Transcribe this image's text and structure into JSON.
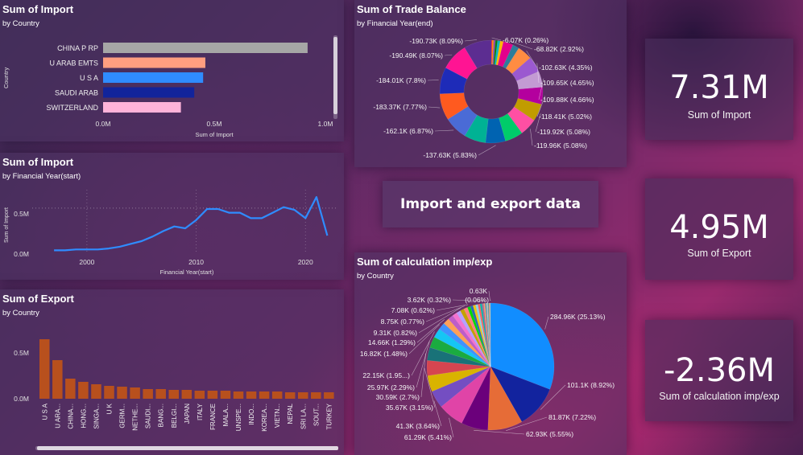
{
  "import_bar": {
    "title": "Sum of Import",
    "subtitle": "by Country",
    "ylabel": "Country",
    "xlabel": "Sum of Import",
    "ticks": [
      "0.0M",
      "0.5M",
      "1.0M"
    ]
  },
  "import_line": {
    "title": "Sum of Import",
    "subtitle": "by Financial Year(start)",
    "ylabel": "Sum of Import",
    "xlabel": "Financial Year(start)",
    "yticks": [
      "0.0M",
      "0.5M"
    ],
    "xticks": [
      "2000",
      "2010",
      "2020"
    ]
  },
  "export_bar": {
    "title": "Sum of Export",
    "subtitle": "by Country",
    "yticks": [
      "0.0M",
      "0.5M"
    ]
  },
  "trade_donut": {
    "title": "Sum of Trade Balance",
    "subtitle": "by Financial Year(end)"
  },
  "calc_pie": {
    "title": "Sum of calculation imp/exp",
    "subtitle": "by Country"
  },
  "banner": {
    "text": "Import and export data"
  },
  "kpis": [
    {
      "value": "7.31M",
      "label": "Sum of Import"
    },
    {
      "value": "4.95M",
      "label": "Sum of Export"
    },
    {
      "value": "-2.36M",
      "label": "Sum of calculation imp/exp"
    }
  ],
  "chart_data": [
    {
      "type": "bar",
      "orientation": "horizontal",
      "title": "Sum of Import",
      "subtitle": "by Country",
      "xlabel": "Sum of Import",
      "ylabel": "Country",
      "categories": [
        "CHINA P RP",
        "U ARAB EMTS",
        "U S A",
        "SAUDI ARAB",
        "SWITZERLAND"
      ],
      "values": [
        0.92,
        0.46,
        0.45,
        0.41,
        0.35
      ],
      "unit": "M",
      "xlim": [
        0,
        1.0
      ],
      "colors": [
        "#a6a6a6",
        "#ff9e80",
        "#2f8cff",
        "#12249b",
        "#ffb3d9"
      ]
    },
    {
      "type": "line",
      "title": "Sum of Import",
      "subtitle": "by Financial Year(start)",
      "xlabel": "Financial Year(start)",
      "ylabel": "Sum of Import",
      "x": [
        1997,
        1998,
        1999,
        2000,
        2001,
        2002,
        2003,
        2004,
        2005,
        2006,
        2007,
        2008,
        2009,
        2010,
        2011,
        2012,
        2013,
        2014,
        2015,
        2016,
        2017,
        2018,
        2019,
        2020,
        2021,
        2022
      ],
      "values": [
        0.04,
        0.04,
        0.05,
        0.05,
        0.05,
        0.06,
        0.08,
        0.11,
        0.14,
        0.19,
        0.25,
        0.3,
        0.28,
        0.37,
        0.49,
        0.49,
        0.45,
        0.45,
        0.39,
        0.39,
        0.45,
        0.51,
        0.48,
        0.39,
        0.62,
        0.2
      ],
      "unit": "M",
      "ylim": [
        0,
        0.7
      ],
      "xlim": [
        1995,
        2023
      ],
      "color": "#2f8cff"
    },
    {
      "type": "bar",
      "title": "Sum of Export",
      "subtitle": "by Country",
      "categories": [
        "U S A",
        "U ARA...",
        "CHINA...",
        "HONG...",
        "SINGA...",
        "U K",
        "GERM...",
        "NETHE...",
        "SAUDI...",
        "BANG...",
        "BELGI...",
        "JAPAN",
        "ITALY",
        "FRANCE",
        "MALA...",
        "UNSPE...",
        "INDO...",
        "KOREA...",
        "VIETN...",
        "NEPAL",
        "SRI LA...",
        "SOUT...",
        "TURKEY"
      ],
      "values": [
        0.74,
        0.48,
        0.25,
        0.21,
        0.18,
        0.16,
        0.15,
        0.14,
        0.12,
        0.12,
        0.11,
        0.11,
        0.1,
        0.1,
        0.1,
        0.09,
        0.09,
        0.09,
        0.09,
        0.08,
        0.08,
        0.08,
        0.08
      ],
      "unit": "M",
      "ylim": [
        0,
        0.9
      ],
      "color": "#b8501d"
    },
    {
      "type": "pie",
      "variant": "donut",
      "title": "Sum of Trade Balance",
      "subtitle": "by Financial Year(end)",
      "slices": [
        {
          "label": "-6.07K (0.26%)",
          "value": 6.07,
          "color": "#e81123"
        },
        {
          "label": "",
          "value": 10,
          "color": "#ff8c00"
        },
        {
          "label": "",
          "value": 12,
          "color": "#8e44ad"
        },
        {
          "label": "",
          "value": 15,
          "color": "#107c10"
        },
        {
          "label": "",
          "value": 18,
          "color": "#00b7c3"
        },
        {
          "label": "",
          "value": 22,
          "color": "#ffb900"
        },
        {
          "label": "-68.82K (2.92%)",
          "value": 68.82,
          "color": "#e3008c"
        },
        {
          "label": "",
          "value": 45,
          "color": "#2d7d9a"
        },
        {
          "label": "-102.63K (4.35%)",
          "value": 102.63,
          "color": "#ff8c42"
        },
        {
          "label": "-109.65K (4.65%)",
          "value": 109.65,
          "color": "#9b59d0"
        },
        {
          "label": "-109.88K (4.66%)",
          "value": 109.88,
          "color": "#c39bd3"
        },
        {
          "label": "-118.41K (5.02%)",
          "value": 118.41,
          "color": "#b4009e"
        },
        {
          "label": "-119.92K (5.08%)",
          "value": 119.92,
          "color": "#c19c00"
        },
        {
          "label": "-119.96K (5.08%)",
          "value": 119.96,
          "color": "#ff4fa3"
        },
        {
          "label": "",
          "value": 125,
          "color": "#00cc6a"
        },
        {
          "label": "-137.63K (5.83%)",
          "value": 137.63,
          "color": "#0063b1"
        },
        {
          "label": "",
          "value": 150,
          "color": "#00b294"
        },
        {
          "label": "-162.1K (6.87%)",
          "value": 162.1,
          "color": "#4a6bd6"
        },
        {
          "label": "-183.37K (7.77%)",
          "value": 183.37,
          "color": "#ff5a1f"
        },
        {
          "label": "-184.01K (7.8%)",
          "value": 184.01,
          "color": "#1e2bb8"
        },
        {
          "label": "-190.49K (8.07%)",
          "value": 190.49,
          "color": "#ff1493"
        },
        {
          "label": "-190.73K (8.09%)",
          "value": 190.73,
          "color": "#5c2d91"
        }
      ]
    },
    {
      "type": "pie",
      "title": "Sum of calculation imp/exp",
      "subtitle": "by Country",
      "slices": [
        {
          "label": "284.96K (25.13%)",
          "value": 284.96,
          "color": "#118dff"
        },
        {
          "label": "101.1K (8.92%)",
          "value": 101.1,
          "color": "#12239e"
        },
        {
          "label": "81.87K (7.22%)",
          "value": 81.87,
          "color": "#e66c37"
        },
        {
          "label": "62.93K (5.55%)",
          "value": 62.93,
          "color": "#6b007b"
        },
        {
          "label": "61.29K (5.41%)",
          "value": 61.29,
          "color": "#e044a7"
        },
        {
          "label": "41.3K (3.64%)",
          "value": 41.3,
          "color": "#744ec2"
        },
        {
          "label": "",
          "value": 38,
          "color": "#d9b300"
        },
        {
          "label": "35.67K (3.15%)",
          "value": 35.67,
          "color": "#d64550"
        },
        {
          "label": "30.59K (2.7%)",
          "value": 30.59,
          "color": "#197278"
        },
        {
          "label": "25.97K (2.29%)",
          "value": 25.97,
          "color": "#1aab40"
        },
        {
          "label": "22.15K (1.95...)",
          "value": 22.15,
          "color": "#15c6f4"
        },
        {
          "label": "16.82K (1.48%)",
          "value": 16.82,
          "color": "#4092ff"
        },
        {
          "label": "14.66K (1.29%)",
          "value": 14.66,
          "color": "#ffa058"
        },
        {
          "label": "",
          "value": 12.5,
          "color": "#be5dc9"
        },
        {
          "label": "",
          "value": 11,
          "color": "#f472d0"
        },
        {
          "label": "",
          "value": 10,
          "color": "#b5a1ff"
        },
        {
          "label": "9.31K (0.82%)",
          "value": 9.31,
          "color": "#c4a200"
        },
        {
          "label": "8.75K (0.77%)",
          "value": 8.75,
          "color": "#ff8080"
        },
        {
          "label": "7.08K (0.62%)",
          "value": 7.08,
          "color": "#00db05"
        },
        {
          "label": "",
          "value": 6.5,
          "color": "#2b6cb0"
        },
        {
          "label": "",
          "value": 6,
          "color": "#f2c80f"
        },
        {
          "label": "",
          "value": 5.5,
          "color": "#8ad4eb"
        },
        {
          "label": "",
          "value": 5,
          "color": "#fd625e"
        },
        {
          "label": "",
          "value": 4.5,
          "color": "#01b8aa"
        },
        {
          "label": "",
          "value": 4,
          "color": "#a66999"
        },
        {
          "label": "3.62K (0.32%)",
          "value": 3.62,
          "color": "#fe9666"
        },
        {
          "label": "",
          "value": 3,
          "color": "#3599b8"
        },
        {
          "label": "",
          "value": 2.5,
          "color": "#dfbfbf"
        },
        {
          "label": "",
          "value": 2,
          "color": "#4ac5bb"
        },
        {
          "label": "",
          "value": 1.5,
          "color": "#5f6b6d"
        },
        {
          "label": "",
          "value": 1.2,
          "color": "#fb8281"
        },
        {
          "label": "",
          "value": 1,
          "color": "#f4d25a"
        },
        {
          "label": "0.63K",
          "value": 0.63,
          "color": "#7f898a"
        },
        {
          "label": "(0.06%)",
          "value": 0.6,
          "color": "#a4ddee"
        }
      ]
    }
  ]
}
